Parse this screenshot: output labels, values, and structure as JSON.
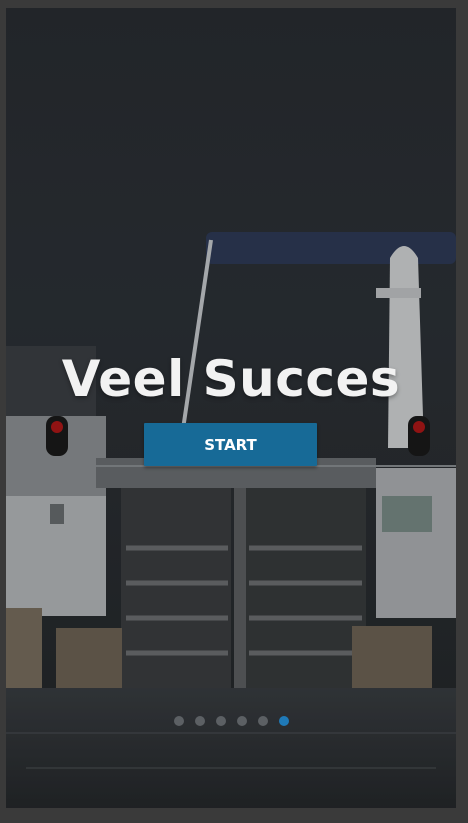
{
  "onboarding": {
    "title": "Veel Succes",
    "start_label": "START",
    "page_indicator": {
      "total_pages": 6,
      "active_page": 6
    },
    "colors": {
      "button": "#176a97",
      "active_dot": "#1f7ab8",
      "inactive_dot": "#5c6064",
      "title_text": "#f2f2f2"
    },
    "background_image": "ship-lock-gates-photo"
  }
}
